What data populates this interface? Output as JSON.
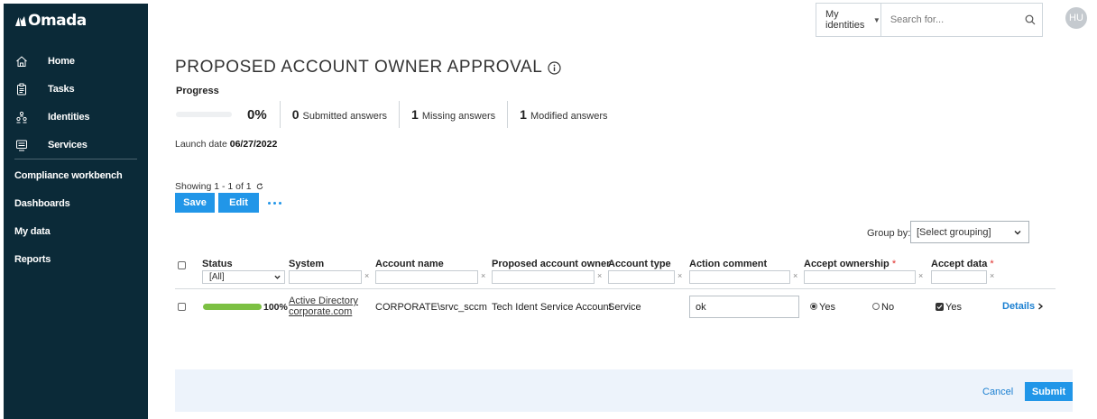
{
  "app": {
    "logo_text": "Omada"
  },
  "sidebar": {
    "items": [
      {
        "label": "Home",
        "icon": "home-icon"
      },
      {
        "label": "Tasks",
        "icon": "tasks-icon"
      },
      {
        "label": "Identities",
        "icon": "identities-icon"
      },
      {
        "label": "Services",
        "icon": "services-icon"
      }
    ],
    "links": [
      "Compliance workbench",
      "Dashboards",
      "My data",
      "Reports"
    ]
  },
  "topbar": {
    "scope": "My identities",
    "search_placeholder": "Search for...",
    "avatar_initials": "HU"
  },
  "page": {
    "title": "PROPOSED ACCOUNT OWNER APPROVAL",
    "progress_label": "Progress",
    "progress_percent": "0%",
    "progress_fraction": 0,
    "stats": [
      {
        "count": "0",
        "label": "Submitted answers"
      },
      {
        "count": "1",
        "label": "Missing answers"
      },
      {
        "count": "1",
        "label": "Modified answers"
      }
    ],
    "launch_label": "Launch date",
    "launch_date": "06/27/2022"
  },
  "toolbar": {
    "showing": "Showing 1 - 1 of 1",
    "save_label": "Save",
    "edit_label": "Edit",
    "group_by_label": "Group by:",
    "group_by_value": "[Select grouping]"
  },
  "table": {
    "headers": {
      "status": "Status",
      "system": "System",
      "account_name": "Account name",
      "proposed_owner": "Proposed account owner",
      "account_type": "Account type",
      "action_comment": "Action comment",
      "accept_ownership": "Accept ownership",
      "accept_data": "Accept data",
      "required_mark": "*"
    },
    "status_filter": "[All]",
    "filter_clear": "×",
    "rows": [
      {
        "status_percent": "100%",
        "status_fraction": 1,
        "system_line1": "Active Directory",
        "system_line2": "corporate.com",
        "account_name": "CORPORATE\\srvc_sccm",
        "proposed_owner": "Tech Ident Service Account",
        "account_type": "Service",
        "action_comment": "ok",
        "ownership_yes": "Yes",
        "ownership_no": "No",
        "ownership_selected": "Yes",
        "accept_data": "Yes",
        "accept_data_checked": true,
        "details": "Details"
      }
    ]
  },
  "footer": {
    "cancel_label": "Cancel",
    "submit_label": "Submit"
  },
  "colors": {
    "sidebar": "#0b2a38",
    "accent": "#2196e8",
    "progress": "#7cc043",
    "footer": "#edf3fb"
  }
}
